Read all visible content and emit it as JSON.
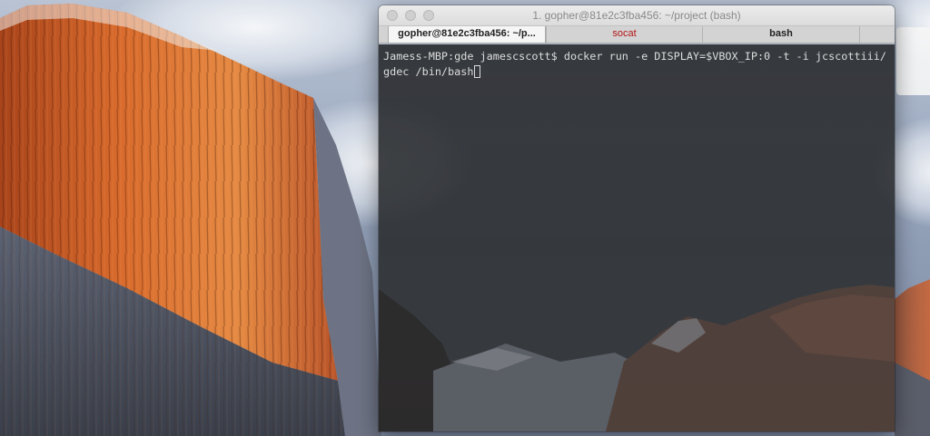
{
  "window": {
    "title": "1. gopher@81e2c3fba456: ~/project (bash)"
  },
  "tabs": [
    {
      "label": "gopher@81e2c3fba456: ~/p...",
      "active": true,
      "alert": false
    },
    {
      "label": "socat",
      "active": false,
      "alert": true
    },
    {
      "label": "bash",
      "active": false,
      "alert": false
    }
  ],
  "terminal": {
    "prompt": "Jamess-MBP:gde jamescscott$ ",
    "command": "docker run -e DISPLAY=$VBOX_IP:0 -t -i jcscottiii/gdec /bin/bash"
  },
  "colors": {
    "alert_tab_text": "#b41414",
    "terminal_text": "#dcdcdc"
  },
  "icons": {
    "close": "traffic-light-close",
    "minimize": "traffic-light-minimize",
    "zoom": "traffic-light-zoom"
  }
}
